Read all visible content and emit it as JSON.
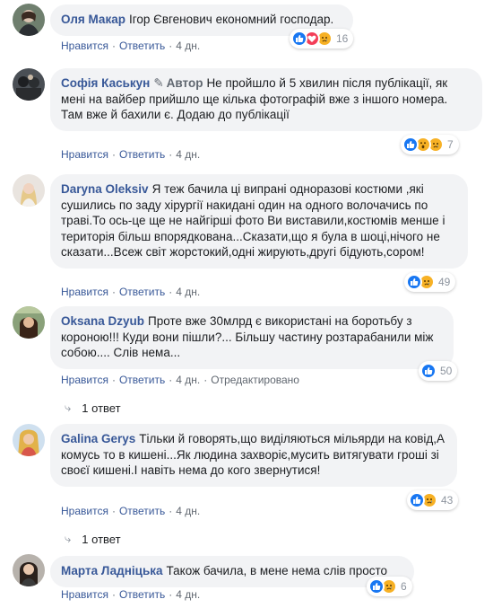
{
  "comments": [
    {
      "name": "Оля Макар",
      "text": "Ігор Євгенович економний господар.",
      "reactions": [
        "like",
        "love",
        "sad"
      ],
      "count": "16",
      "actions": [
        "Нравится",
        "Ответить"
      ],
      "time": "4 дн."
    },
    {
      "name": "Софія Каськун",
      "badge": "Автор",
      "text": "Не пройшло й 5 хвилин після публікації, як мені на вайбер прийшло ще кілька фотографій вже з іншого номера. Там вже й бахили є. Додаю до публікації",
      "reactions": [
        "like",
        "wow",
        "sad"
      ],
      "count": "7",
      "actions": [
        "Нравится",
        "Ответить"
      ],
      "time": "4 дн."
    },
    {
      "name": "Daryna Oleksiv",
      "text": "Я теж бачила ці випрані одноразові костюми ,які сушились по заду хірургії накидані один на одного волочачись по траві.То ось-це ще не найгірші фото Ви виставили,костюмів менше і територія більш впорядкована...Сказати,що я була в шоці,нічого не сказати...Всеж світ жорстокий,одні жирують,другі бідують,сором!",
      "reactions": [
        "like",
        "sad"
      ],
      "count": "49",
      "actions": [
        "Нравится",
        "Ответить"
      ],
      "time": "4 дн."
    },
    {
      "name": "Oksana Dzyub",
      "text": "Проте вже 30млрд є використані на боротьбу з короною!!! Куди вони пішли?... Більшу частину розтарабанили між собою.... Слів нема...",
      "reactions": [
        "like"
      ],
      "count": "50",
      "actions": [
        "Нравится",
        "Ответить"
      ],
      "time": "4 дн.",
      "edited": "Отредактировано",
      "replies": "1 ответ"
    },
    {
      "name": "Galina Gerys",
      "text": "Тільки й говорять,що виділяються мільярди на ковід,А комусь то в кишені...Як людина захворіє,мусить витягувати гроші зі своєї кишені.І навіть нема до кого звернутися!",
      "reactions": [
        "like",
        "sad"
      ],
      "count": "43",
      "actions": [
        "Нравится",
        "Ответить"
      ],
      "time": "4 дн.",
      "replies": "1 ответ"
    },
    {
      "name": "Марта Ладніцька",
      "text": "Також бачила, в мене нема слів просто",
      "reactions": [
        "like",
        "sad"
      ],
      "count": "6",
      "actions": [
        "Нравится",
        "Ответить"
      ],
      "time": "4 дн."
    }
  ],
  "colors": {
    "link": "#385898",
    "bubble": "#f2f3f5",
    "like": "#1877f2",
    "love": "#f33e58",
    "emoji": "#f7b125"
  }
}
